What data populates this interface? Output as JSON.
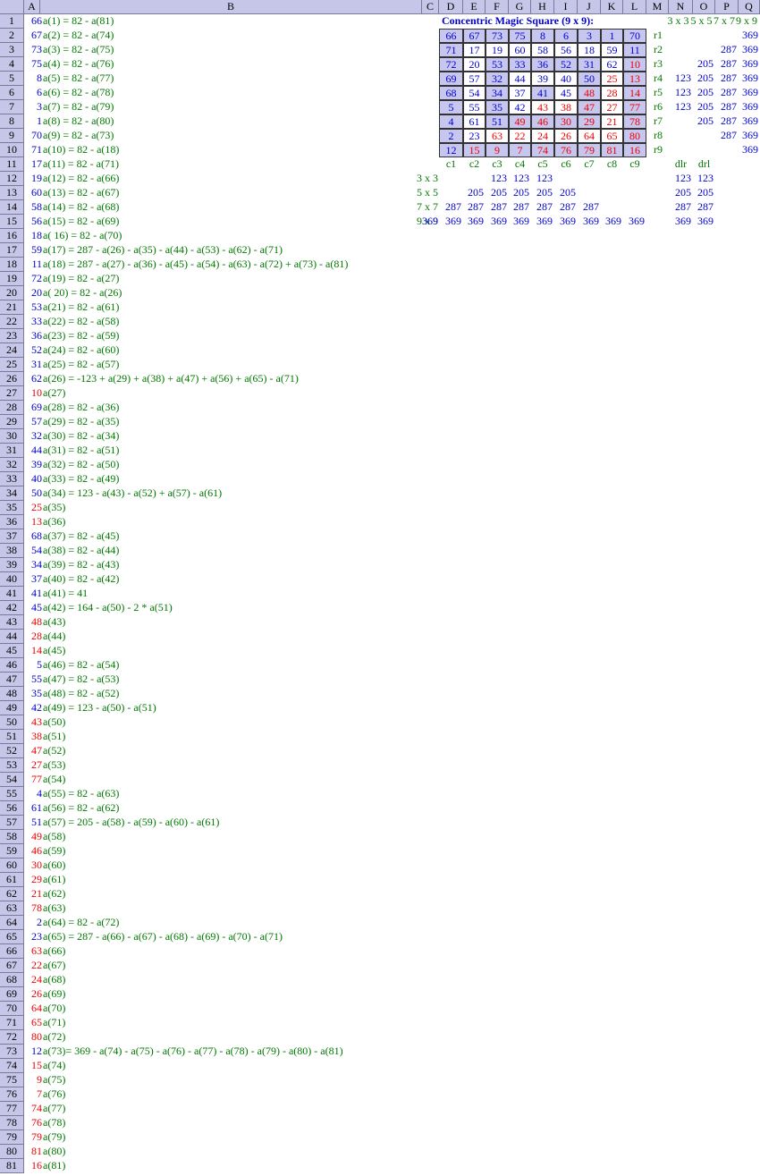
{
  "columns": [
    "A",
    "B",
    "C",
    "D",
    "E",
    "F",
    "G",
    "H",
    "I",
    "J",
    "K",
    "L",
    "M",
    "N",
    "O",
    "P",
    "Q"
  ],
  "rows_a": [
    {
      "v": "66",
      "c": "blue",
      "f": "a(1) = 82 - a(81)"
    },
    {
      "v": "67",
      "c": "blue",
      "f": "a(2) = 82 - a(74)"
    },
    {
      "v": "73",
      "c": "blue",
      "f": "a(3) = 82 - a(75)"
    },
    {
      "v": "75",
      "c": "blue",
      "f": "a(4) = 82 - a(76)"
    },
    {
      "v": "8",
      "c": "blue",
      "f": "a(5) = 82 - a(77)"
    },
    {
      "v": "6",
      "c": "blue",
      "f": "a(6) = 82 - a(78)"
    },
    {
      "v": "3",
      "c": "blue",
      "f": "a(7) = 82 - a(79)"
    },
    {
      "v": "1",
      "c": "blue",
      "f": "a(8) = 82 - a(80)"
    },
    {
      "v": "70",
      "c": "blue",
      "f": "a(9) = 82 - a(73)"
    },
    {
      "v": "71",
      "c": "blue",
      "f": "a(10) = 82 - a(18)"
    },
    {
      "v": "17",
      "c": "blue",
      "f": "a(11) = 82 - a(71)"
    },
    {
      "v": "19",
      "c": "blue",
      "f": "a(12) = 82 - a(66)"
    },
    {
      "v": "60",
      "c": "blue",
      "f": "a(13) = 82 - a(67)"
    },
    {
      "v": "58",
      "c": "blue",
      "f": "a(14) = 82 - a(68)"
    },
    {
      "v": "56",
      "c": "blue",
      "f": "a(15) = 82 - a(69)"
    },
    {
      "v": "18",
      "c": "blue",
      "f": "a( 16) = 82 - a(70)"
    },
    {
      "v": "59",
      "c": "blue",
      "f": "a(17) = 287 - a(26) - a(35) - a(44) - a(53) - a(62) - a(71)"
    },
    {
      "v": "11",
      "c": "blue",
      "f": "a(18) = 287 - a(27) - a(36) - a(45) - a(54) - a(63) - a(72) + a(73) - a(81)"
    },
    {
      "v": "72",
      "c": "blue",
      "f": "a(19) = 82 - a(27)"
    },
    {
      "v": "20",
      "c": "blue",
      "f": "a( 20) = 82 - a(26)"
    },
    {
      "v": "53",
      "c": "blue",
      "f": "a(21) = 82 - a(61)"
    },
    {
      "v": "33",
      "c": "blue",
      "f": "a(22) = 82 - a(58)"
    },
    {
      "v": "36",
      "c": "blue",
      "f": "a(23) = 82 - a(59)"
    },
    {
      "v": "52",
      "c": "blue",
      "f": "a(24) = 82 - a(60)"
    },
    {
      "v": "31",
      "c": "blue",
      "f": "a(25) = 82 - a(57)"
    },
    {
      "v": "62",
      "c": "blue",
      "f": "a(26) = -123 + a(29) + a(38) + a(47) + a(56) + a(65) - a(71)"
    },
    {
      "v": "10",
      "c": "red",
      "f": "a(27)"
    },
    {
      "v": "69",
      "c": "blue",
      "f": "a(28) = 82 - a(36)"
    },
    {
      "v": "57",
      "c": "blue",
      "f": "a(29) = 82 - a(35)"
    },
    {
      "v": "32",
      "c": "blue",
      "f": "a(30) = 82 - a(34)"
    },
    {
      "v": "44",
      "c": "blue",
      "f": "a(31) = 82 - a(51)"
    },
    {
      "v": "39",
      "c": "blue",
      "f": "a(32) = 82 - a(50)"
    },
    {
      "v": "40",
      "c": "blue",
      "f": "a(33) = 82 - a(49)"
    },
    {
      "v": "50",
      "c": "blue",
      "f": "a(34) = 123 - a(43) - a(52) + a(57) - a(61)"
    },
    {
      "v": "25",
      "c": "red",
      "f": "a(35)"
    },
    {
      "v": "13",
      "c": "red",
      "f": "a(36)"
    },
    {
      "v": "68",
      "c": "blue",
      "f": "a(37) = 82 - a(45)"
    },
    {
      "v": "54",
      "c": "blue",
      "f": "a(38) = 82 - a(44)"
    },
    {
      "v": "34",
      "c": "blue",
      "f": "a(39) = 82 - a(43)"
    },
    {
      "v": "37",
      "c": "blue",
      "f": "a(40) = 82 - a(42)"
    },
    {
      "v": "41",
      "c": "blue",
      "f": "a(41) = 41"
    },
    {
      "v": "45",
      "c": "blue",
      "f": "a(42) = 164 - a(50) - 2 * a(51)"
    },
    {
      "v": "48",
      "c": "red",
      "f": "a(43)"
    },
    {
      "v": "28",
      "c": "red",
      "f": "a(44)"
    },
    {
      "v": "14",
      "c": "red",
      "f": "a(45)"
    },
    {
      "v": "5",
      "c": "blue",
      "f": "a(46) = 82 - a(54)"
    },
    {
      "v": "55",
      "c": "blue",
      "f": "a(47) = 82 - a(53)"
    },
    {
      "v": "35",
      "c": "blue",
      "f": "a(48) = 82 - a(52)"
    },
    {
      "v": "42",
      "c": "blue",
      "f": "a(49) = 123 - a(50) - a(51)"
    },
    {
      "v": "43",
      "c": "red",
      "f": "a(50)"
    },
    {
      "v": "38",
      "c": "red",
      "f": "a(51)"
    },
    {
      "v": "47",
      "c": "red",
      "f": "a(52)"
    },
    {
      "v": "27",
      "c": "red",
      "f": "a(53)"
    },
    {
      "v": "77",
      "c": "red",
      "f": "a(54)"
    },
    {
      "v": "4",
      "c": "blue",
      "f": "a(55) = 82 - a(63)"
    },
    {
      "v": "61",
      "c": "blue",
      "f": "a(56) = 82 - a(62)"
    },
    {
      "v": "51",
      "c": "blue",
      "f": "a(57) = 205 - a(58) - a(59) - a(60) - a(61)"
    },
    {
      "v": "49",
      "c": "red",
      "f": "a(58)"
    },
    {
      "v": "46",
      "c": "red",
      "f": "a(59)"
    },
    {
      "v": "30",
      "c": "red",
      "f": "a(60)"
    },
    {
      "v": "29",
      "c": "red",
      "f": "a(61)"
    },
    {
      "v": "21",
      "c": "red",
      "f": "a(62)"
    },
    {
      "v": "78",
      "c": "red",
      "f": "a(63)"
    },
    {
      "v": "2",
      "c": "blue",
      "f": "a(64) = 82 - a(72)"
    },
    {
      "v": "23",
      "c": "blue",
      "f": "a(65) = 287 - a(66) - a(67) - a(68) - a(69) - a(70) - a(71)"
    },
    {
      "v": "63",
      "c": "red",
      "f": "a(66)"
    },
    {
      "v": "22",
      "c": "red",
      "f": "a(67)"
    },
    {
      "v": "24",
      "c": "red",
      "f": "a(68)"
    },
    {
      "v": "26",
      "c": "red",
      "f": "a(69)"
    },
    {
      "v": "64",
      "c": "red",
      "f": "a(70)"
    },
    {
      "v": "65",
      "c": "red",
      "f": "a(71)"
    },
    {
      "v": "80",
      "c": "red",
      "f": "a(72)"
    },
    {
      "v": "12",
      "c": "blue",
      "f": "a(73)= 369 - a(74) - a(75) - a(76) - a(77) - a(78) - a(79) - a(80) - a(81)"
    },
    {
      "v": "15",
      "c": "red",
      "f": "a(74)"
    },
    {
      "v": "9",
      "c": "red",
      "f": "a(75)"
    },
    {
      "v": "7",
      "c": "red",
      "f": "a(76)"
    },
    {
      "v": "74",
      "c": "red",
      "f": "a(77)"
    },
    {
      "v": "76",
      "c": "red",
      "f": "a(78)"
    },
    {
      "v": "79",
      "c": "red",
      "f": "a(79)"
    },
    {
      "v": "81",
      "c": "red",
      "f": "a(80)"
    },
    {
      "v": "16",
      "c": "red",
      "f": "a(81)"
    }
  ],
  "square": {
    "title": "Concentric Magic Square (9 x 9):",
    "cells": [
      [
        {
          "v": "66",
          "bg": "lav",
          "c": "blue"
        },
        {
          "v": "67",
          "bg": "lav",
          "c": "blue"
        },
        {
          "v": "73",
          "bg": "lav",
          "c": "blue"
        },
        {
          "v": "75",
          "bg": "lav",
          "c": "blue"
        },
        {
          "v": "8",
          "bg": "lav",
          "c": "blue"
        },
        {
          "v": "6",
          "bg": "lav",
          "c": "blue"
        },
        {
          "v": "3",
          "bg": "lav",
          "c": "blue"
        },
        {
          "v": "1",
          "bg": "lav",
          "c": "blue"
        },
        {
          "v": "70",
          "bg": "lav",
          "c": "blue"
        }
      ],
      [
        {
          "v": "71",
          "bg": "lav",
          "c": "blue"
        },
        {
          "v": "17",
          "bg": "wht",
          "c": "blue"
        },
        {
          "v": "19",
          "bg": "wht",
          "c": "blue"
        },
        {
          "v": "60",
          "bg": "wht",
          "c": "blue"
        },
        {
          "v": "58",
          "bg": "wht",
          "c": "blue"
        },
        {
          "v": "56",
          "bg": "wht",
          "c": "blue"
        },
        {
          "v": "18",
          "bg": "wht",
          "c": "blue"
        },
        {
          "v": "59",
          "bg": "wht",
          "c": "blue"
        },
        {
          "v": "11",
          "bg": "lav",
          "c": "blue"
        }
      ],
      [
        {
          "v": "72",
          "bg": "lav",
          "c": "blue"
        },
        {
          "v": "20",
          "bg": "wht",
          "c": "blue"
        },
        {
          "v": "53",
          "bg": "lav",
          "c": "blue"
        },
        {
          "v": "33",
          "bg": "lav",
          "c": "blue"
        },
        {
          "v": "36",
          "bg": "lav",
          "c": "blue"
        },
        {
          "v": "52",
          "bg": "lav",
          "c": "blue"
        },
        {
          "v": "31",
          "bg": "lav",
          "c": "blue"
        },
        {
          "v": "62",
          "bg": "wht",
          "c": "blue"
        },
        {
          "v": "10",
          "bg": "lav",
          "c": "red"
        }
      ],
      [
        {
          "v": "69",
          "bg": "lav",
          "c": "blue"
        },
        {
          "v": "57",
          "bg": "wht",
          "c": "blue"
        },
        {
          "v": "32",
          "bg": "lav",
          "c": "blue"
        },
        {
          "v": "44",
          "bg": "wht",
          "c": "blue"
        },
        {
          "v": "39",
          "bg": "wht",
          "c": "blue"
        },
        {
          "v": "40",
          "bg": "wht",
          "c": "blue"
        },
        {
          "v": "50",
          "bg": "lav",
          "c": "blue"
        },
        {
          "v": "25",
          "bg": "wht",
          "c": "red"
        },
        {
          "v": "13",
          "bg": "lav",
          "c": "red"
        }
      ],
      [
        {
          "v": "68",
          "bg": "lav",
          "c": "blue"
        },
        {
          "v": "54",
          "bg": "wht",
          "c": "blue"
        },
        {
          "v": "34",
          "bg": "lav",
          "c": "blue"
        },
        {
          "v": "37",
          "bg": "wht",
          "c": "blue"
        },
        {
          "v": "41",
          "bg": "lav",
          "c": "blue"
        },
        {
          "v": "45",
          "bg": "wht",
          "c": "blue"
        },
        {
          "v": "48",
          "bg": "lav",
          "c": "red"
        },
        {
          "v": "28",
          "bg": "wht",
          "c": "red"
        },
        {
          "v": "14",
          "bg": "lav",
          "c": "red"
        }
      ],
      [
        {
          "v": "5",
          "bg": "lav",
          "c": "blue"
        },
        {
          "v": "55",
          "bg": "wht",
          "c": "blue"
        },
        {
          "v": "35",
          "bg": "lav",
          "c": "blue"
        },
        {
          "v": "42",
          "bg": "wht",
          "c": "blue"
        },
        {
          "v": "43",
          "bg": "wht",
          "c": "red"
        },
        {
          "v": "38",
          "bg": "wht",
          "c": "red"
        },
        {
          "v": "47",
          "bg": "lav",
          "c": "red"
        },
        {
          "v": "27",
          "bg": "wht",
          "c": "red"
        },
        {
          "v": "77",
          "bg": "lav",
          "c": "red"
        }
      ],
      [
        {
          "v": "4",
          "bg": "lav",
          "c": "blue"
        },
        {
          "v": "61",
          "bg": "wht",
          "c": "blue"
        },
        {
          "v": "51",
          "bg": "lav",
          "c": "blue"
        },
        {
          "v": "49",
          "bg": "lav",
          "c": "red"
        },
        {
          "v": "46",
          "bg": "lav",
          "c": "red"
        },
        {
          "v": "30",
          "bg": "lav",
          "c": "red"
        },
        {
          "v": "29",
          "bg": "lav",
          "c": "red"
        },
        {
          "v": "21",
          "bg": "wht",
          "c": "red"
        },
        {
          "v": "78",
          "bg": "lav",
          "c": "red"
        }
      ],
      [
        {
          "v": "2",
          "bg": "lav",
          "c": "blue"
        },
        {
          "v": "23",
          "bg": "wht",
          "c": "blue"
        },
        {
          "v": "63",
          "bg": "wht",
          "c": "red"
        },
        {
          "v": "22",
          "bg": "wht",
          "c": "red"
        },
        {
          "v": "24",
          "bg": "wht",
          "c": "red"
        },
        {
          "v": "26",
          "bg": "wht",
          "c": "red"
        },
        {
          "v": "64",
          "bg": "wht",
          "c": "red"
        },
        {
          "v": "65",
          "bg": "wht",
          "c": "red"
        },
        {
          "v": "80",
          "bg": "lav",
          "c": "red"
        }
      ],
      [
        {
          "v": "12",
          "bg": "lav",
          "c": "blue"
        },
        {
          "v": "15",
          "bg": "lav",
          "c": "red"
        },
        {
          "v": "9",
          "bg": "lav",
          "c": "red"
        },
        {
          "v": "7",
          "bg": "lav",
          "c": "red"
        },
        {
          "v": "74",
          "bg": "lav",
          "c": "red"
        },
        {
          "v": "76",
          "bg": "lav",
          "c": "red"
        },
        {
          "v": "79",
          "bg": "lav",
          "c": "red"
        },
        {
          "v": "81",
          "bg": "lav",
          "c": "red"
        },
        {
          "v": "16",
          "bg": "lav",
          "c": "red"
        }
      ]
    ],
    "row_labels": [
      "r1",
      "r2",
      "r3",
      "r4",
      "r5",
      "r6",
      "r7",
      "r8",
      "r9"
    ],
    "col_labels": [
      "c1",
      "c2",
      "c3",
      "c4",
      "c5",
      "c6",
      "c7",
      "c8",
      "c9"
    ],
    "size_headers": [
      "3 x 3",
      "5 x 5",
      "7 x 7",
      "9 x 9"
    ],
    "row_sums": [
      [
        "",
        "",
        "",
        "369"
      ],
      [
        "",
        "",
        "287",
        "369"
      ],
      [
        "",
        "205",
        "287",
        "369"
      ],
      [
        "123",
        "205",
        "287",
        "369"
      ],
      [
        "123",
        "205",
        "287",
        "369"
      ],
      [
        "123",
        "205",
        "287",
        "369"
      ],
      [
        "",
        "205",
        "287",
        "369"
      ],
      [
        "",
        "",
        "287",
        "369"
      ],
      [
        "",
        "",
        "",
        "369"
      ]
    ],
    "col_sum_labels": [
      "3 x 3",
      "5 x 5",
      "7 x 7",
      "9 x 9"
    ],
    "col_sums": [
      [
        "",
        "",
        "",
        "123",
        "123",
        "123",
        "",
        "",
        "",
        ""
      ],
      [
        "",
        "",
        "205",
        "205",
        "205",
        "205",
        "205",
        "",
        "",
        ""
      ],
      [
        "",
        "287",
        "287",
        "287",
        "287",
        "287",
        "287",
        "287",
        "",
        ""
      ],
      [
        "369",
        "369",
        "369",
        "369",
        "369",
        "369",
        "369",
        "369",
        "369",
        "369"
      ]
    ],
    "diag_labels": [
      "dlr",
      "drl"
    ],
    "diag_sums": [
      [
        "123",
        "123"
      ],
      [
        "205",
        "205"
      ],
      [
        "287",
        "287"
      ],
      [
        "369",
        "369"
      ]
    ]
  },
  "colors": {
    "blue": "#0000cc",
    "red": "#ee0000",
    "green": "#007700",
    "header": "#c6c6e8",
    "lavender": "#c6c6ee"
  }
}
